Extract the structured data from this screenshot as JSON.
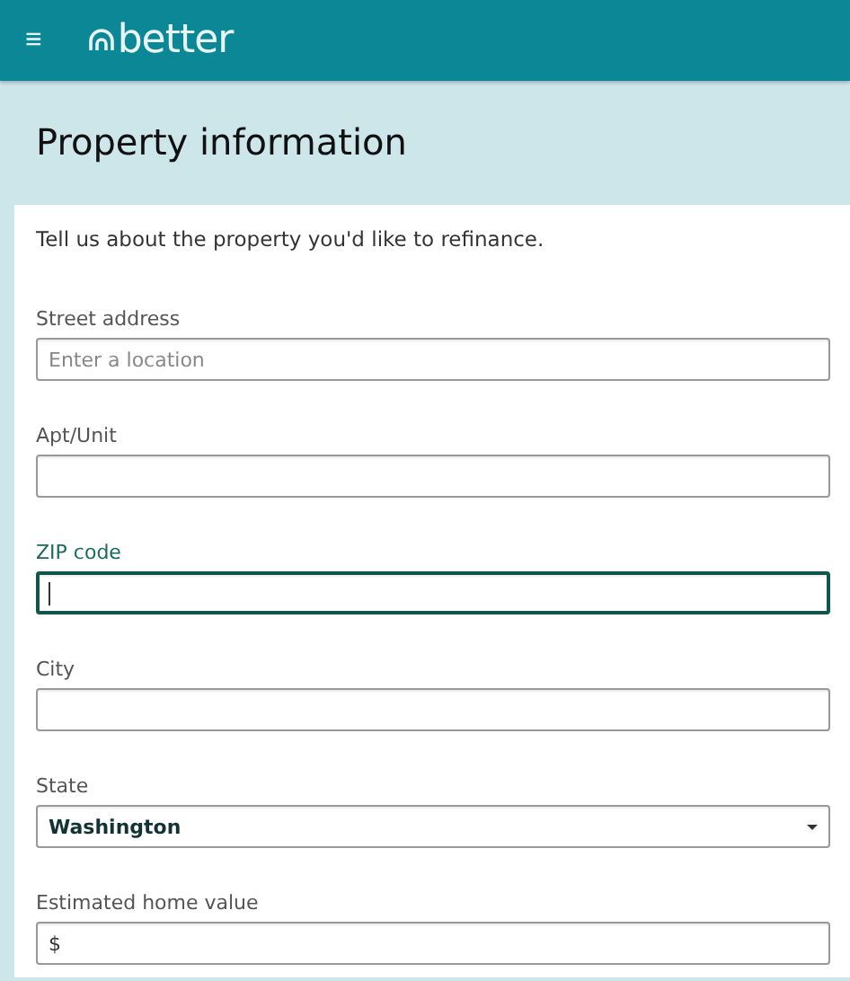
{
  "header": {
    "menu_icon": "≡",
    "logo": "better"
  },
  "page_title": "Property information",
  "form": {
    "intro": "Tell us about the property you'd like to refinance.",
    "fields": [
      {
        "kind": "text",
        "label": "Street address",
        "placeholder": "Enter a location",
        "focused": false
      },
      {
        "kind": "text",
        "label": "Apt/Unit",
        "focused": false
      },
      {
        "kind": "text",
        "label": "ZIP code",
        "focused": true
      },
      {
        "kind": "text",
        "label": "City",
        "focused": false
      },
      {
        "kind": "select",
        "label": "State",
        "value": "Washington",
        "focused": false
      },
      {
        "kind": "text",
        "label": "Estimated home value",
        "prefix": "$",
        "focused": false
      }
    ]
  }
}
